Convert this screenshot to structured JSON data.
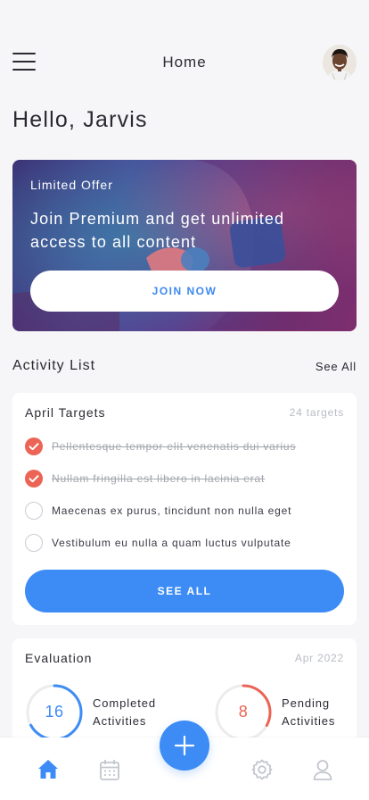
{
  "header": {
    "title": "Home",
    "menu_icon": "hamburger-menu-icon",
    "avatar": "user-avatar"
  },
  "greeting": "Hello, Jarvis",
  "banner": {
    "tag": "Limited Offer",
    "headline": "Join Premium and get unlimited access to all content",
    "button_label": "JOIN NOW"
  },
  "activity": {
    "title": "Activity List",
    "see_all_link": "See All"
  },
  "targets": {
    "title": "April Targets",
    "count": "24 targets",
    "tasks": [
      {
        "text": "Pellentesque tempor elit venenatis dui varius",
        "done": true
      },
      {
        "text": "Nullam fringilla est libero in lacinia erat",
        "done": true
      },
      {
        "text": "Maecenas ex purus, tincidunt non nulla eget",
        "done": false
      },
      {
        "text": "Vestibulum eu nulla a quam luctus vulputate",
        "done": false
      }
    ],
    "button_label": "SEE ALL"
  },
  "evaluation": {
    "title": "Evaluation",
    "period": "Apr 2022",
    "stats": [
      {
        "value": "16",
        "label_line1": "Completed",
        "label_line2": "Activities",
        "progress": 0.67,
        "color": "#3d8cf5"
      },
      {
        "value": "8",
        "label_line1": "Pending",
        "label_line2": "Activities",
        "progress": 0.33,
        "color": "#ec6455"
      }
    ]
  },
  "nav": {
    "items": [
      "home-icon",
      "calendar-icon",
      "add-icon",
      "settings-icon",
      "profile-icon"
    ],
    "active": "home-icon",
    "accent": "#3d8cf5",
    "inactive": "#c3c6cd"
  }
}
